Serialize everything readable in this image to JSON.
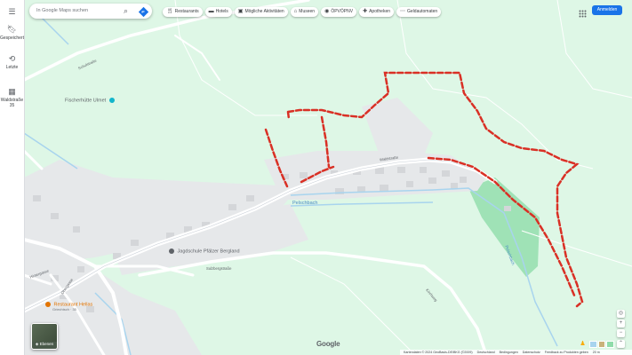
{
  "rail": {
    "items": [
      {
        "label": "",
        "icon": "menu-icon"
      },
      {
        "label": "Gespeichert",
        "icon": "bookmark-icon"
      },
      {
        "label": "Letzte",
        "icon": "history-icon"
      },
      {
        "label": "Waldstraße 35",
        "icon": "place-thumbnail-icon"
      }
    ]
  },
  "search": {
    "placeholder": "In Google Maps suchen"
  },
  "chips": [
    {
      "label": "Restaurants",
      "icon": "restaurant-icon"
    },
    {
      "label": "Hotels",
      "icon": "hotel-icon"
    },
    {
      "label": "Mögliche Aktivitäten",
      "icon": "activities-icon"
    },
    {
      "label": "Museen",
      "icon": "museum-icon"
    },
    {
      "label": "ÖPVÖPNV",
      "icon": "transit-icon"
    },
    {
      "label": "Apotheken",
      "icon": "pharmacy-icon"
    },
    {
      "label": "Geldautomaten",
      "icon": "atm-icon"
    }
  ],
  "header": {
    "signin_label": "Anmelden"
  },
  "map": {
    "places": [
      {
        "name": "Fischerhütte Ulmet"
      },
      {
        "name": "Jagdschule Pfälzer Bergland"
      },
      {
        "name": "Restaurant Hellas",
        "sub": "Griechisch · 35"
      }
    ],
    "roads": [
      "Schulstraße",
      "Waldstraße",
      "Sulzbergstraße",
      "Hintergasse",
      "Obergasse",
      "Kirchweg"
    ],
    "water": [
      "Pelschbach",
      "Pelschbach"
    ],
    "route_color": "#d93025",
    "park_color": "#8fdcaa",
    "water_color": "#a8d4ee"
  },
  "layers": {
    "label": "Ebenen"
  },
  "brand": {
    "logo": "Google"
  },
  "footer": {
    "items": [
      "Kartendaten © 2024 GeoBasis-DE/BKG (©2009)",
      "Deutschland",
      "Bedingungen",
      "Datenschutz",
      "Feedback zu Produkten geben",
      "20 m"
    ]
  }
}
